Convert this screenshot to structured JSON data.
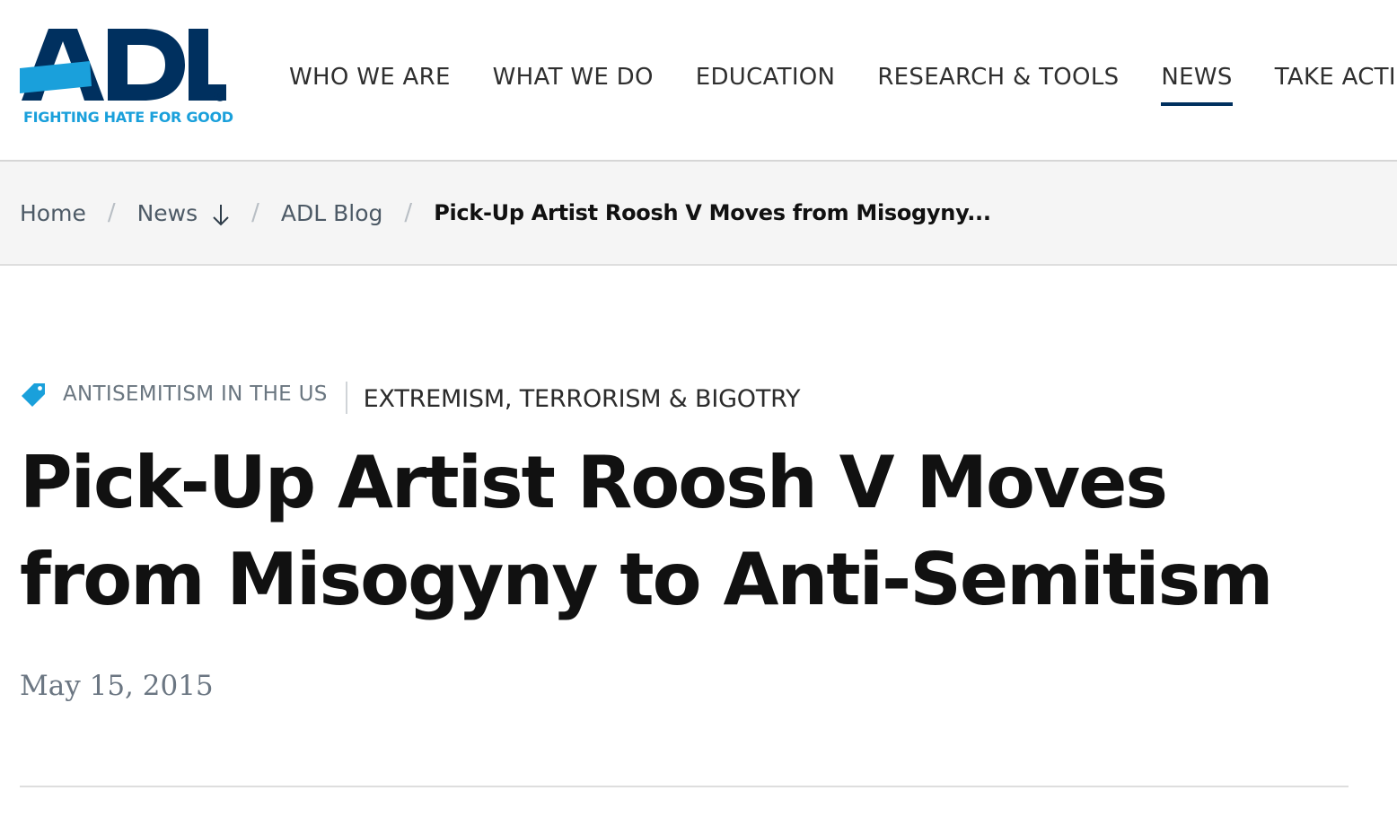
{
  "brand": {
    "logo_text": "ADL",
    "tagline": "FIGHTING HATE FOR GOOD",
    "registered_mark": "®",
    "colors": {
      "navy": "#00305f",
      "light_blue": "#1aa0db"
    }
  },
  "nav": {
    "items": [
      {
        "label": "WHO WE ARE"
      },
      {
        "label": "WHAT WE DO"
      },
      {
        "label": "EDUCATION"
      },
      {
        "label": "RESEARCH & TOOLS"
      },
      {
        "label": "NEWS",
        "active": true
      },
      {
        "label": "TAKE ACTION"
      }
    ]
  },
  "breadcrumb": {
    "home": "Home",
    "news": "News",
    "news_icon": "arrow-down-icon",
    "blog": "ADL Blog",
    "current": "Pick-Up Artist Roosh V Moves from Misogyny...",
    "separator": "/"
  },
  "tags": {
    "icon": "tag-icon",
    "primary": "ANTISEMITISM IN THE US",
    "secondary": "EXTREMISM, TERRORISM & BIGOTRY"
  },
  "article": {
    "title": "Pick-Up Artist Roosh V Moves from Misogyny to Anti-Semitism",
    "date": "May 15, 2015"
  }
}
